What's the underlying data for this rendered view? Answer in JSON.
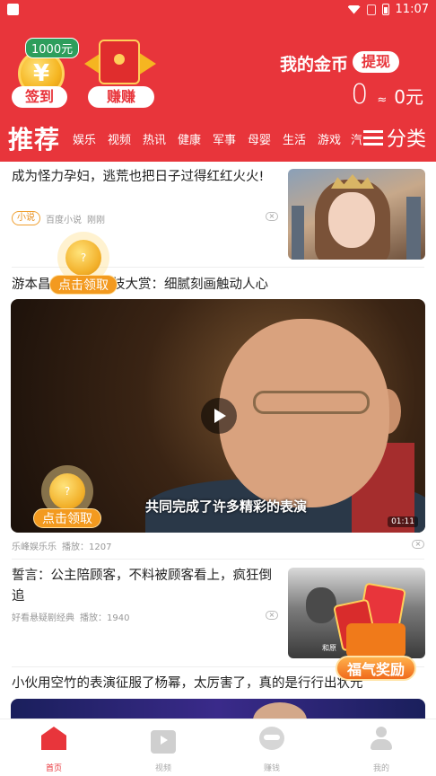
{
  "status_bar": {
    "time": "11:07"
  },
  "header": {
    "sign_in": {
      "amount": "1000元",
      "coin_symbol": "¥",
      "label": "签到"
    },
    "earn": {
      "label": "赚赚"
    },
    "coins": {
      "title": "我的金币",
      "withdraw_label": "提现",
      "count": "0",
      "approx": "≈",
      "money": "0元"
    }
  },
  "tabs": {
    "active": "推荐",
    "items": [
      "娱乐",
      "视频",
      "热讯",
      "健康",
      "军事",
      "母婴",
      "生活",
      "游戏"
    ],
    "truncated": "汽",
    "category_label": "分类"
  },
  "feed": {
    "articles": [
      {
        "title": "成为怪力孕妇，逃荒也把日子过得红红火火!",
        "tag": "小说",
        "source": "百度小说",
        "time": "刚刚"
      },
      {
        "title": "游本昌",
        "title_tail": "技大赏：细腻刻画触动人心",
        "subtitle": "共同完成了许多精彩的表演",
        "duration": "01:11",
        "source": "乐峰娱乐乐",
        "plays": "播放：1207"
      },
      {
        "title": "誓言：公主陪顾客，不料被顾客看上，疯狂倒追",
        "source": "好看悬疑剧经典",
        "plays": "播放：1940",
        "thumb_caption": "和原"
      },
      {
        "title": "小伙用空竹的表演征服了杨幂，太厉害了，真的是行行出状元"
      }
    ]
  },
  "floating": {
    "claim_label": "点击领取",
    "coin_mark": "?",
    "lucky_label": "福气奖励"
  },
  "bottom_nav": {
    "items": [
      {
        "label": "首页"
      },
      {
        "label": "视频"
      },
      {
        "label": "赚钱"
      },
      {
        "label": "我的"
      }
    ]
  },
  "colors": {
    "brand": "#e8353b",
    "accent": "#f39a1f"
  },
  "icons": [
    "app-icon",
    "wifi-icon",
    "no-sim-icon",
    "battery-icon",
    "menu-icon",
    "play-icon",
    "close-icon",
    "home-icon",
    "video-icon",
    "earn-icon",
    "profile-icon"
  ]
}
